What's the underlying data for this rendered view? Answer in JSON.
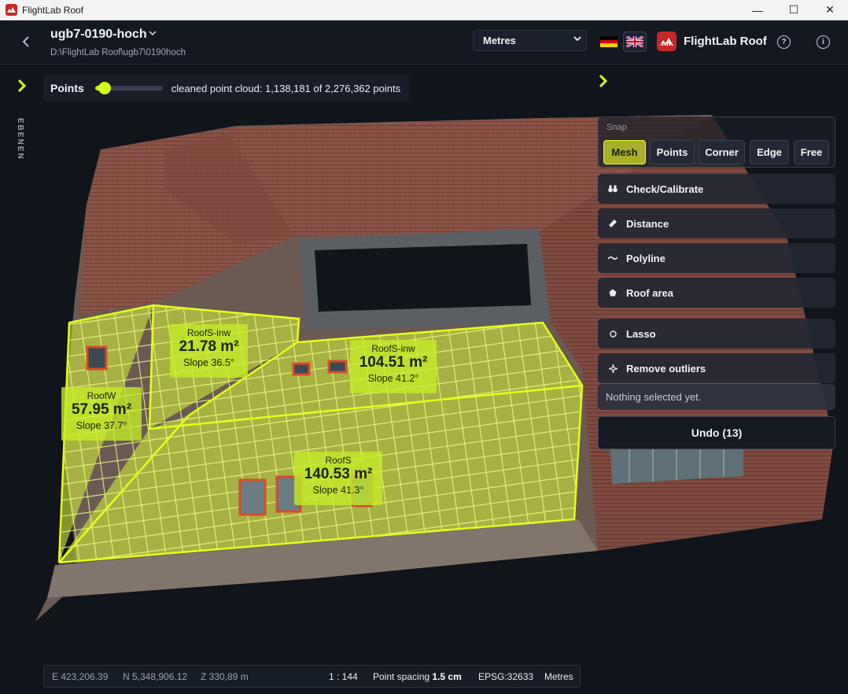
{
  "window": {
    "title": "FlightLab Roof",
    "controls": [
      "—",
      "☐",
      "✕"
    ]
  },
  "header": {
    "project_name": "ugb7-0190-hoch",
    "project_path": "D:\\FlightLab Roof\\ugb7\\0190hoch",
    "units_selected": "Metres",
    "brand": "FlightLab Roof",
    "help_glyph": "?",
    "info_glyph": "i"
  },
  "sidebar": {
    "layers_tab": "EBENEN"
  },
  "points": {
    "label": "Points",
    "level": 0.14,
    "info": "cleaned point cloud: 1,138,181 of 2,276,362 points"
  },
  "snap": {
    "label": "Snap",
    "options": [
      "Mesh",
      "Points",
      "Corner",
      "Edge",
      "Free"
    ],
    "active": "Mesh"
  },
  "tools": [
    {
      "label": "Check/Calibrate",
      "icon": "binoculars-icon"
    },
    {
      "label": "Distance",
      "icon": "ruler-icon"
    },
    {
      "label": "Polyline",
      "icon": "polyline-icon"
    },
    {
      "label": "Roof area",
      "icon": "pentagon-icon"
    },
    {
      "label": "Lasso",
      "icon": "lasso-icon"
    },
    {
      "label": "Remove outliers",
      "icon": "outliers-icon"
    }
  ],
  "selection_status": "Nothing selected yet.",
  "undo_label": "Undo (13)",
  "measurements": [
    {
      "name": "RoofS-inw",
      "area": "21.78 m²",
      "slope": "Slope 36.5°"
    },
    {
      "name": "RoofS-inw",
      "area": "104.51 m²",
      "slope": "Slope 41.2°"
    },
    {
      "name": "RoofW",
      "area": "57.95 m²",
      "slope": "Slope 37.7°"
    },
    {
      "name": "RoofS",
      "area": "140.53 m²",
      "slope": "Slope 41.3°"
    }
  ],
  "statusbar": {
    "e": "E 423,206.39",
    "n": "N 5,348,906.12",
    "z": "Z 330,89 m",
    "scale": "1 : 144",
    "spacing_label": "Point spacing",
    "spacing_value": "1.5 cm",
    "epsg": "EPSG:32633",
    "units": "Metres"
  },
  "colors": {
    "accent": "#d7ff1f",
    "highlight_fill": "#c4ec28",
    "roof_tile": "#8a5347",
    "brand_red": "#c62828",
    "background": "#10141b"
  }
}
